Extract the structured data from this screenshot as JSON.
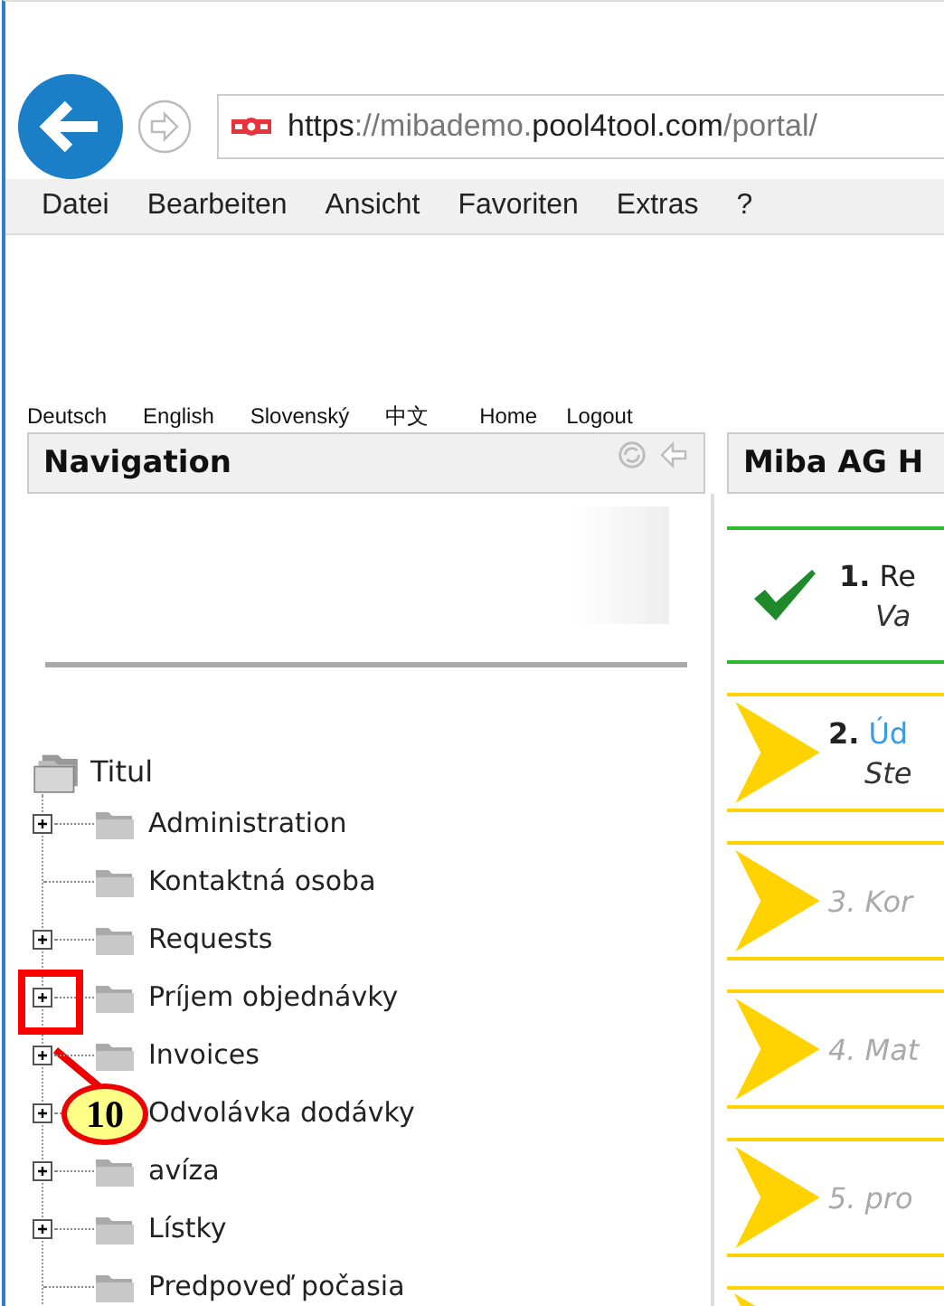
{
  "browser": {
    "url_parts": [
      {
        "text": "https",
        "strong": true
      },
      {
        "text": "://mibademo.",
        "strong": false
      },
      {
        "text": "pool4tool.com",
        "strong": true
      },
      {
        "text": "/portal/",
        "strong": false
      }
    ],
    "menu": [
      "Datei",
      "Bearbeiten",
      "Ansicht",
      "Favoriten",
      "Extras",
      "?"
    ]
  },
  "languages": [
    "Deutsch",
    "English",
    "Slovenský",
    "中文"
  ],
  "links": [
    "Home",
    "Logout"
  ],
  "navigation": {
    "title": "Navigation",
    "tree": {
      "label": "Titul",
      "children": [
        {
          "label": "Administration",
          "expandable": true,
          "highlighted": false
        },
        {
          "label": "Kontaktná osoba",
          "expandable": false,
          "highlighted": false
        },
        {
          "label": "Requests",
          "expandable": true,
          "highlighted": false
        },
        {
          "label": "Príjem objednávky",
          "expandable": true,
          "highlighted": true
        },
        {
          "label": "Invoices",
          "expandable": true,
          "highlighted": false
        },
        {
          "label": "Odvolávka dodávky",
          "expandable": true,
          "highlighted": false
        },
        {
          "label": "avíza",
          "expandable": true,
          "highlighted": false
        },
        {
          "label": "Lístky",
          "expandable": true,
          "highlighted": false
        },
        {
          "label": "Predpoveď počasia",
          "expandable": false,
          "highlighted": false
        }
      ]
    }
  },
  "callout": {
    "label": "10"
  },
  "main": {
    "title": "Miba AG H",
    "steps": [
      {
        "number": "1.",
        "title": "Re",
        "subtitle": "Va",
        "completed": true,
        "active": false
      },
      {
        "number": "2.",
        "title": "Úd",
        "subtitle": "Ste",
        "completed": false,
        "active": true
      },
      {
        "number": "3.",
        "title": "Kor",
        "completed": false,
        "active": false
      },
      {
        "number": "4.",
        "title": "Mat",
        "completed": false,
        "active": false
      },
      {
        "number": "5.",
        "title": "pro",
        "completed": false,
        "active": false
      }
    ]
  }
}
